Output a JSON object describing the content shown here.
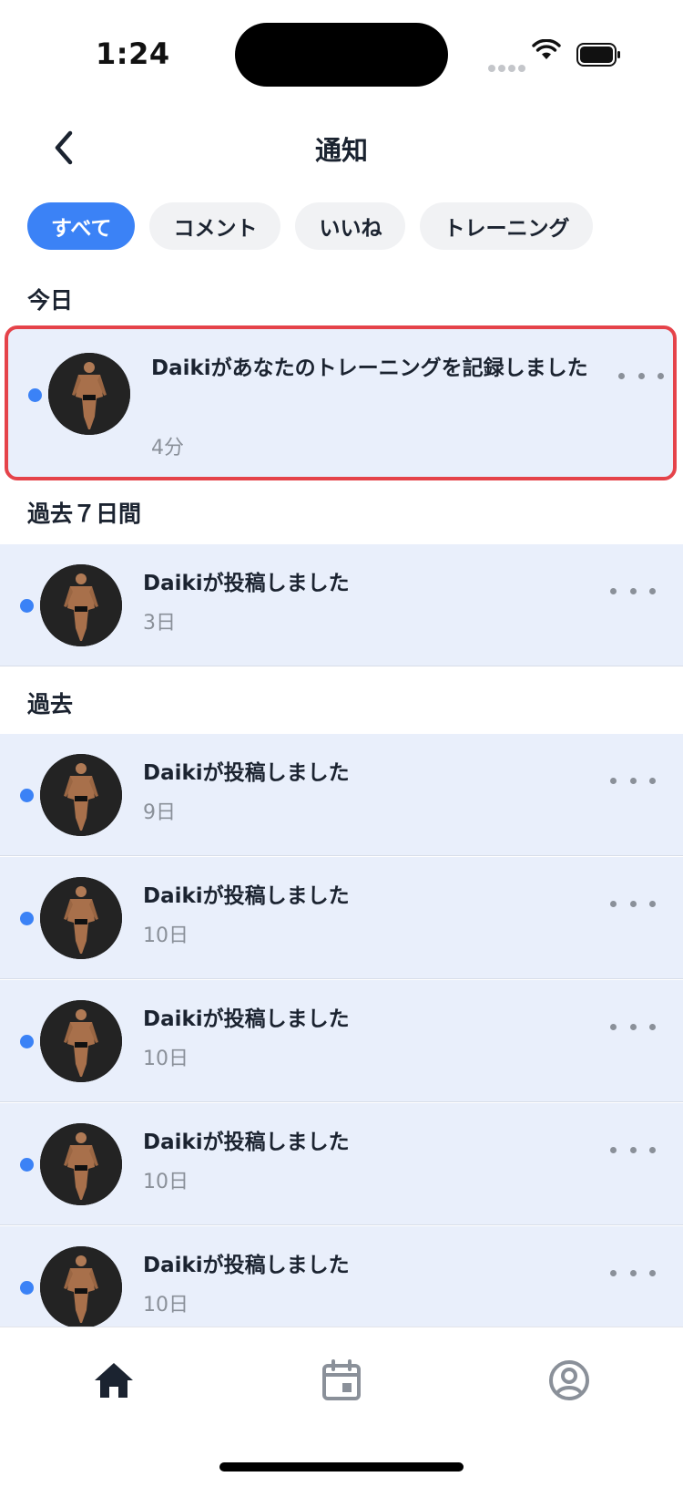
{
  "status_bar": {
    "time": "1:24"
  },
  "header": {
    "title": "通知"
  },
  "filters": [
    "すべて",
    "コメント",
    "いいね",
    "トレーニング"
  ],
  "sections": {
    "today": "今日",
    "last7": "過去７日間",
    "past": "過去"
  },
  "notifications": [
    {
      "text": "Daikiがあなたのトレーニングを記録しました",
      "time": "4分"
    },
    {
      "text": "Daikiが投稿しました",
      "time": "3日"
    },
    {
      "text": "Daikiが投稿しました",
      "time": "9日"
    },
    {
      "text": "Daikiが投稿しました",
      "time": "10日"
    },
    {
      "text": "Daikiが投稿しました",
      "time": "10日"
    },
    {
      "text": "Daikiが投稿しました",
      "time": "10日"
    },
    {
      "text": "Daikiが投稿しました",
      "time": "10日"
    }
  ],
  "tabs": [
    {
      "icon": "home-icon",
      "active": true
    },
    {
      "icon": "calendar-icon",
      "active": false
    },
    {
      "icon": "profile-icon",
      "active": false
    }
  ],
  "colors": {
    "accent": "#3b82f6",
    "row_background": "#e9effb",
    "highlight_border": "#e5434a",
    "text": "#1b2330",
    "muted": "#8a9099"
  }
}
